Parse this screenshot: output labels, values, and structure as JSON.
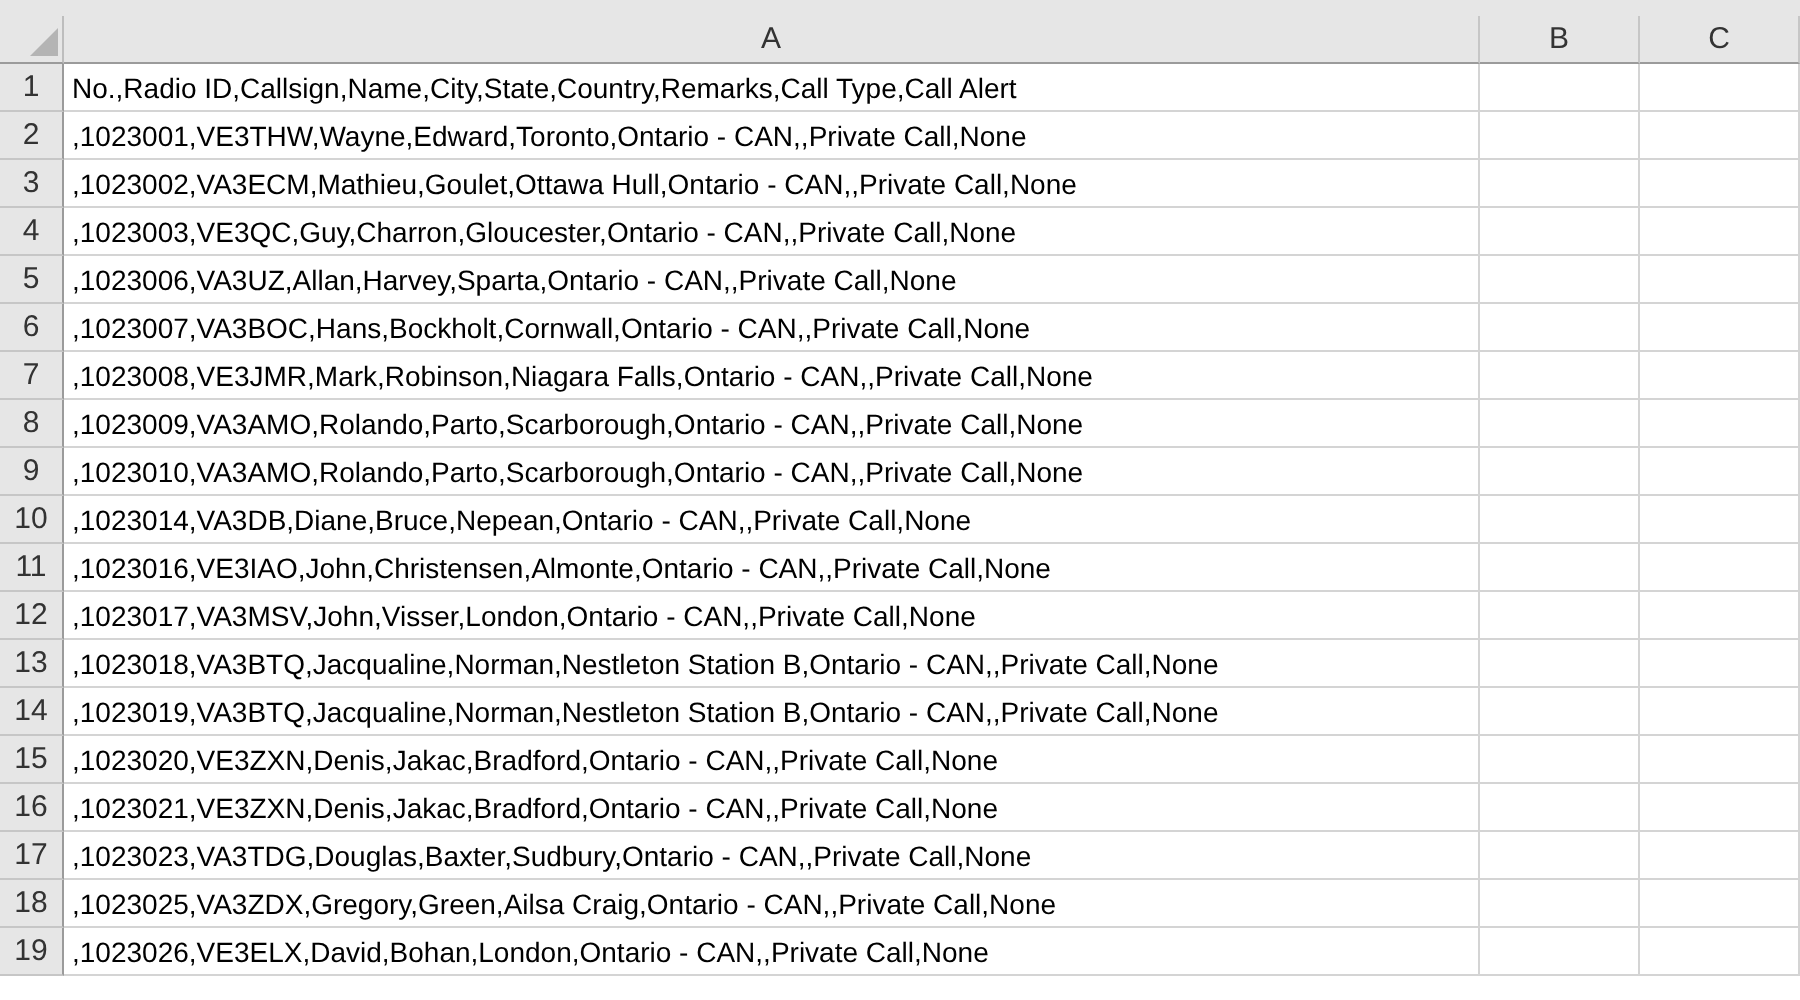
{
  "columns": [
    "A",
    "B",
    "C"
  ],
  "rows": [
    {
      "number": "1",
      "cells": [
        "No.,Radio ID,Callsign,Name,City,State,Country,Remarks,Call Type,Call Alert"
      ]
    },
    {
      "number": "2",
      "cells": [
        ",1023001,VE3THW,Wayne,Edward,Toronto,Ontario - CAN,,Private Call,None"
      ]
    },
    {
      "number": "3",
      "cells": [
        ",1023002,VA3ECM,Mathieu,Goulet,Ottawa Hull,Ontario - CAN,,Private Call,None"
      ]
    },
    {
      "number": "4",
      "cells": [
        ",1023003,VE3QC,Guy,Charron,Gloucester,Ontario - CAN,,Private Call,None"
      ]
    },
    {
      "number": "5",
      "cells": [
        ",1023006,VA3UZ,Allan,Harvey,Sparta,Ontario - CAN,,Private Call,None"
      ]
    },
    {
      "number": "6",
      "cells": [
        ",1023007,VA3BOC,Hans,Bockholt,Cornwall,Ontario - CAN,,Private Call,None"
      ]
    },
    {
      "number": "7",
      "cells": [
        ",1023008,VE3JMR,Mark,Robinson,Niagara Falls,Ontario - CAN,,Private Call,None"
      ]
    },
    {
      "number": "8",
      "cells": [
        ",1023009,VA3AMO,Rolando,Parto,Scarborough,Ontario - CAN,,Private Call,None"
      ]
    },
    {
      "number": "9",
      "cells": [
        ",1023010,VA3AMO,Rolando,Parto,Scarborough,Ontario - CAN,,Private Call,None"
      ]
    },
    {
      "number": "10",
      "cells": [
        ",1023014,VA3DB,Diane,Bruce,Nepean,Ontario - CAN,,Private Call,None"
      ]
    },
    {
      "number": "11",
      "cells": [
        ",1023016,VE3IAO,John,Christensen,Almonte,Ontario - CAN,,Private Call,None"
      ]
    },
    {
      "number": "12",
      "cells": [
        ",1023017,VA3MSV,John,Visser,London,Ontario - CAN,,Private Call,None"
      ]
    },
    {
      "number": "13",
      "cells": [
        ",1023018,VA3BTQ,Jacqualine,Norman,Nestleton Station B,Ontario - CAN,,Private Call,None"
      ]
    },
    {
      "number": "14",
      "cells": [
        ",1023019,VA3BTQ,Jacqualine,Norman,Nestleton Station B,Ontario - CAN,,Private Call,None"
      ]
    },
    {
      "number": "15",
      "cells": [
        ",1023020,VE3ZXN,Denis,Jakac,Bradford,Ontario - CAN,,Private Call,None"
      ]
    },
    {
      "number": "16",
      "cells": [
        ",1023021,VE3ZXN,Denis,Jakac,Bradford,Ontario - CAN,,Private Call,None"
      ]
    },
    {
      "number": "17",
      "cells": [
        ",1023023,VA3TDG,Douglas,Baxter,Sudbury,Ontario - CAN,,Private Call,None"
      ]
    },
    {
      "number": "18",
      "cells": [
        ",1023025,VA3ZDX,Gregory,Green,Ailsa Craig,Ontario - CAN,,Private Call,None"
      ]
    },
    {
      "number": "19",
      "cells": [
        ",1023026,VE3ELX,David,Bohan,London,Ontario - CAN,,Private Call,None"
      ]
    }
  ]
}
